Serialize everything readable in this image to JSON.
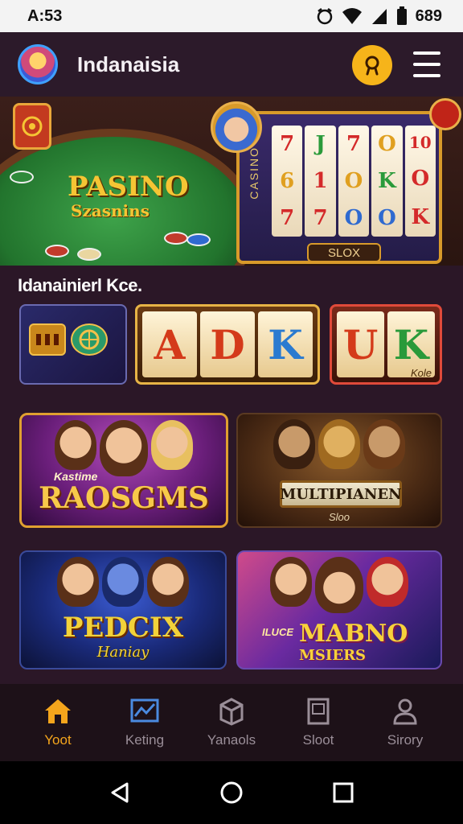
{
  "status_bar": {
    "time": "A:53",
    "battery_text": "689"
  },
  "header": {
    "title": "Indanaisia"
  },
  "banner": {
    "title": "PASINO",
    "subtitle": "Szasnins",
    "slot_side_text": "CASINO",
    "slot_button_label": "SLOX",
    "reels": [
      [
        "7",
        "6",
        "7"
      ],
      [
        "J",
        "1",
        "7"
      ],
      [
        "7",
        "O",
        "O"
      ],
      [
        "O",
        "K",
        "O"
      ],
      [
        "10",
        "O",
        "K"
      ]
    ]
  },
  "section": {
    "title": "Idanainierl Kce."
  },
  "tiles": {
    "t2_letters": [
      "A",
      "D",
      "K"
    ],
    "t3_letters": [
      "U",
      "K"
    ],
    "t3_sub": "Kole"
  },
  "cards": [
    {
      "kicker": "Kastime",
      "title": "RAOSGMS"
    },
    {
      "title": "MULTIPIANEN",
      "subtitle": "Sloo"
    },
    {
      "title": "PEDCIX",
      "subtitle": "Haniay"
    },
    {
      "kicker": "ILUCE",
      "title": "MABNO",
      "subtitle": "MSIERS"
    }
  ],
  "bottom_nav": [
    {
      "label": "Yoot",
      "icon": "home-icon",
      "active": true
    },
    {
      "label": "Keting",
      "icon": "chart-icon",
      "active": false
    },
    {
      "label": "Yanaols",
      "icon": "box-icon",
      "active": false
    },
    {
      "label": "Sloot",
      "icon": "slot-machine-icon",
      "active": false
    },
    {
      "label": "Sirory",
      "icon": "profile-icon",
      "active": false
    }
  ],
  "colors": {
    "accent": "#f4a51c",
    "background": "#2b1727",
    "nav_inactive": "#9a8e98"
  }
}
